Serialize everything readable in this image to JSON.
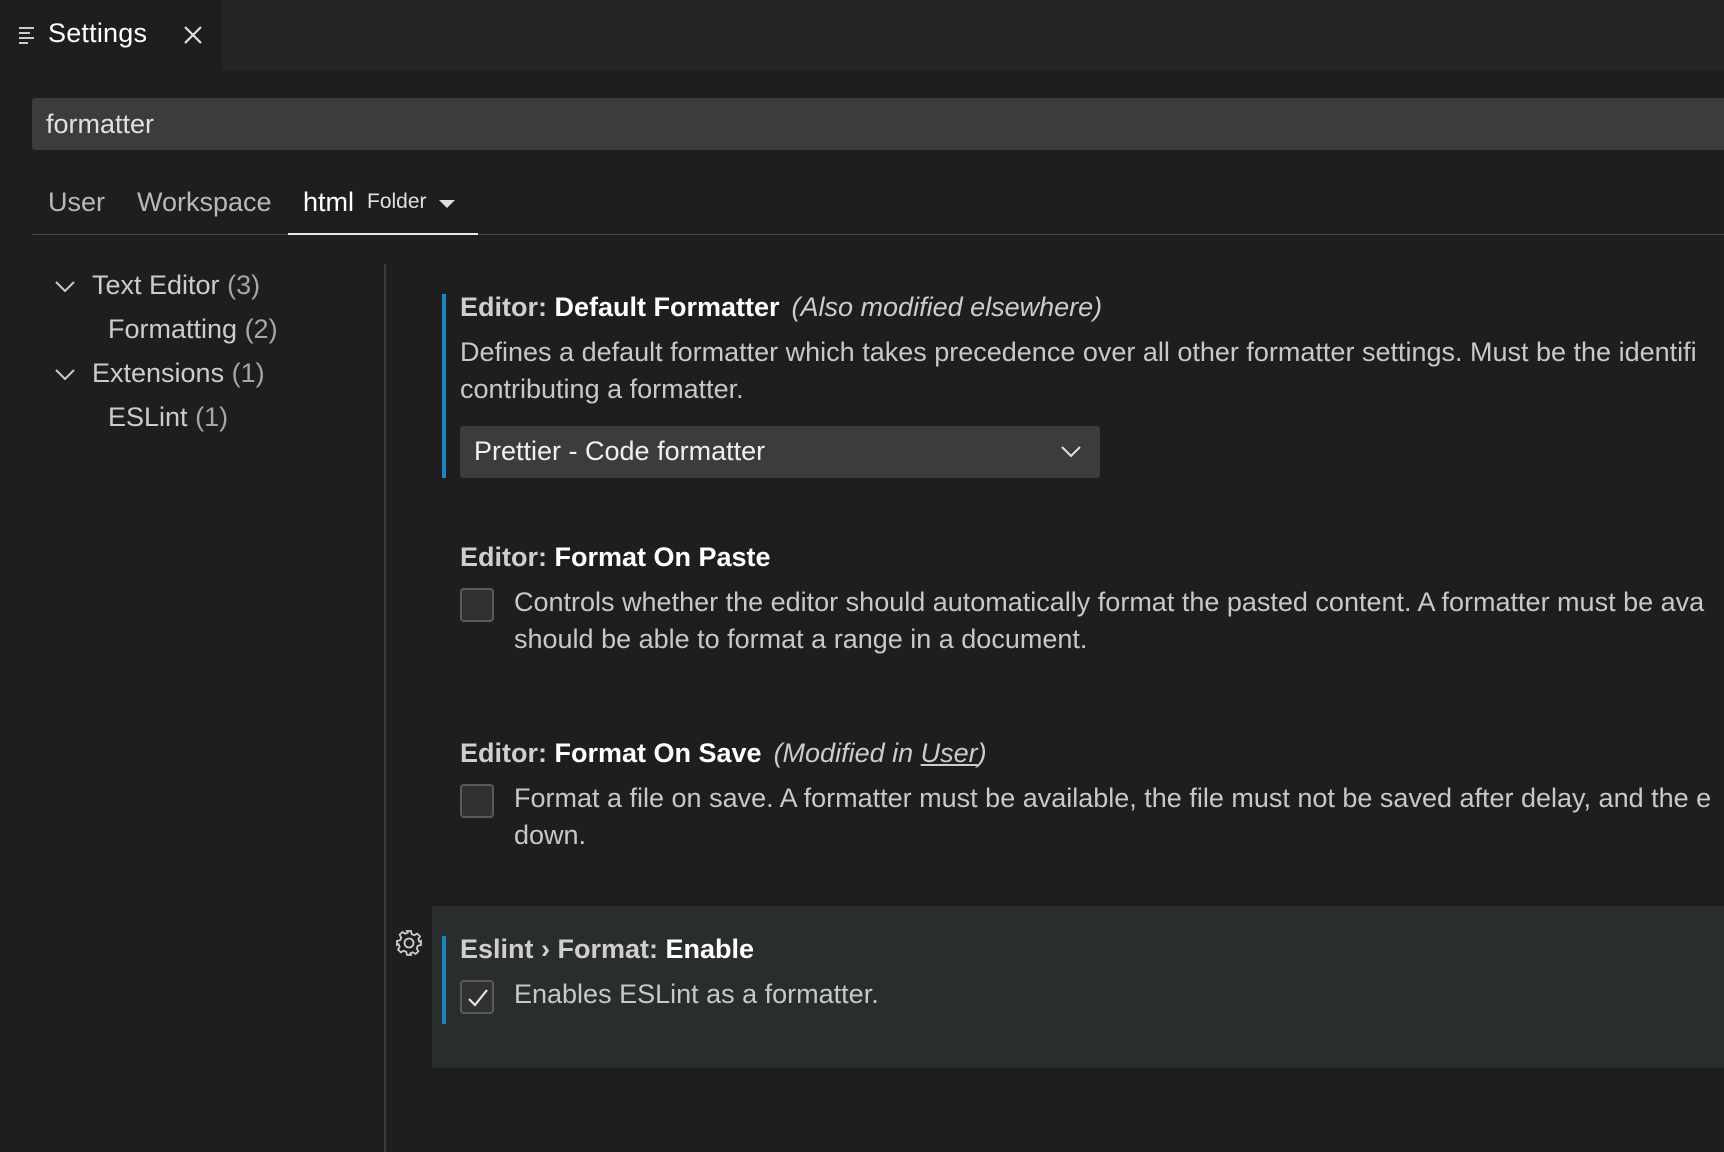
{
  "tab": {
    "title": "Settings",
    "icon": "settings-list-icon",
    "close_icon": "close-icon"
  },
  "search": {
    "value": "formatter"
  },
  "scopes": {
    "user": "User",
    "workspace": "Workspace",
    "folder_name": "html",
    "folder_kind": "Folder"
  },
  "toc": {
    "items": [
      {
        "label": "Text Editor",
        "count": "(3)"
      },
      {
        "label": "Formatting",
        "count": "(2)"
      },
      {
        "label": "Extensions",
        "count": "(1)"
      },
      {
        "label": "ESLint",
        "count": "(1)"
      }
    ]
  },
  "settings": [
    {
      "category": "Editor: ",
      "key": "Default Formatter",
      "modified": "(Also modified elsewhere)",
      "desc_line1": "Defines a default formatter which takes precedence over all other formatter settings. Must be the identifi",
      "desc_line2": "contributing a formatter.",
      "select_value": "Prettier - Code formatter"
    },
    {
      "category": "Editor: ",
      "key": "Format On Paste",
      "checked": false,
      "desc_line1": "Controls whether the editor should automatically format the pasted content. A formatter must be ava",
      "desc_line2": "should be able to format a range in a document."
    },
    {
      "category": "Editor: ",
      "key": "Format On Save",
      "modified_prefix": "(Modified in ",
      "modified_link": "User",
      "modified_suffix": ")",
      "checked": false,
      "desc_line1": "Format a file on save. A formatter must be available, the file must not be saved after delay, and the e",
      "desc_line2": "down."
    },
    {
      "category": "Eslint › Format: ",
      "key": "Enable",
      "checked": true,
      "desc_line1": "Enables ESLint as a formatter."
    }
  ],
  "colors": {
    "modified_indicator": "#1a85c2",
    "background": "#1e1e1e",
    "input_background": "#3c3c3c"
  }
}
